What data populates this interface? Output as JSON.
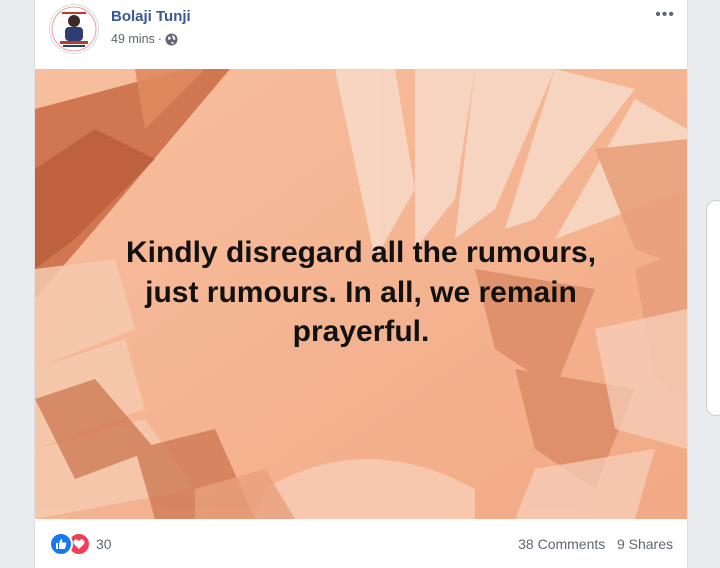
{
  "post": {
    "author": "Bolaji Tunji",
    "time": "49 mins",
    "separator": "·",
    "privacy_icon": "globe-icon",
    "more_label": "•••",
    "quote_lines": [
      "Kindly disregard all the rumours,",
      "just rumours. In all, we remain",
      "prayerful."
    ]
  },
  "engagement": {
    "reaction_icons": [
      "like-icon",
      "love-icon"
    ],
    "reaction_count": "30",
    "comments": "38 Comments",
    "shares": "9 Shares"
  },
  "colors": {
    "background": "#f4b391",
    "leaf_light": "#f7d2bd",
    "leaf_dark": "#c96b44",
    "author_link": "#385898",
    "like": "#1877f2",
    "love": "#f33e58"
  }
}
